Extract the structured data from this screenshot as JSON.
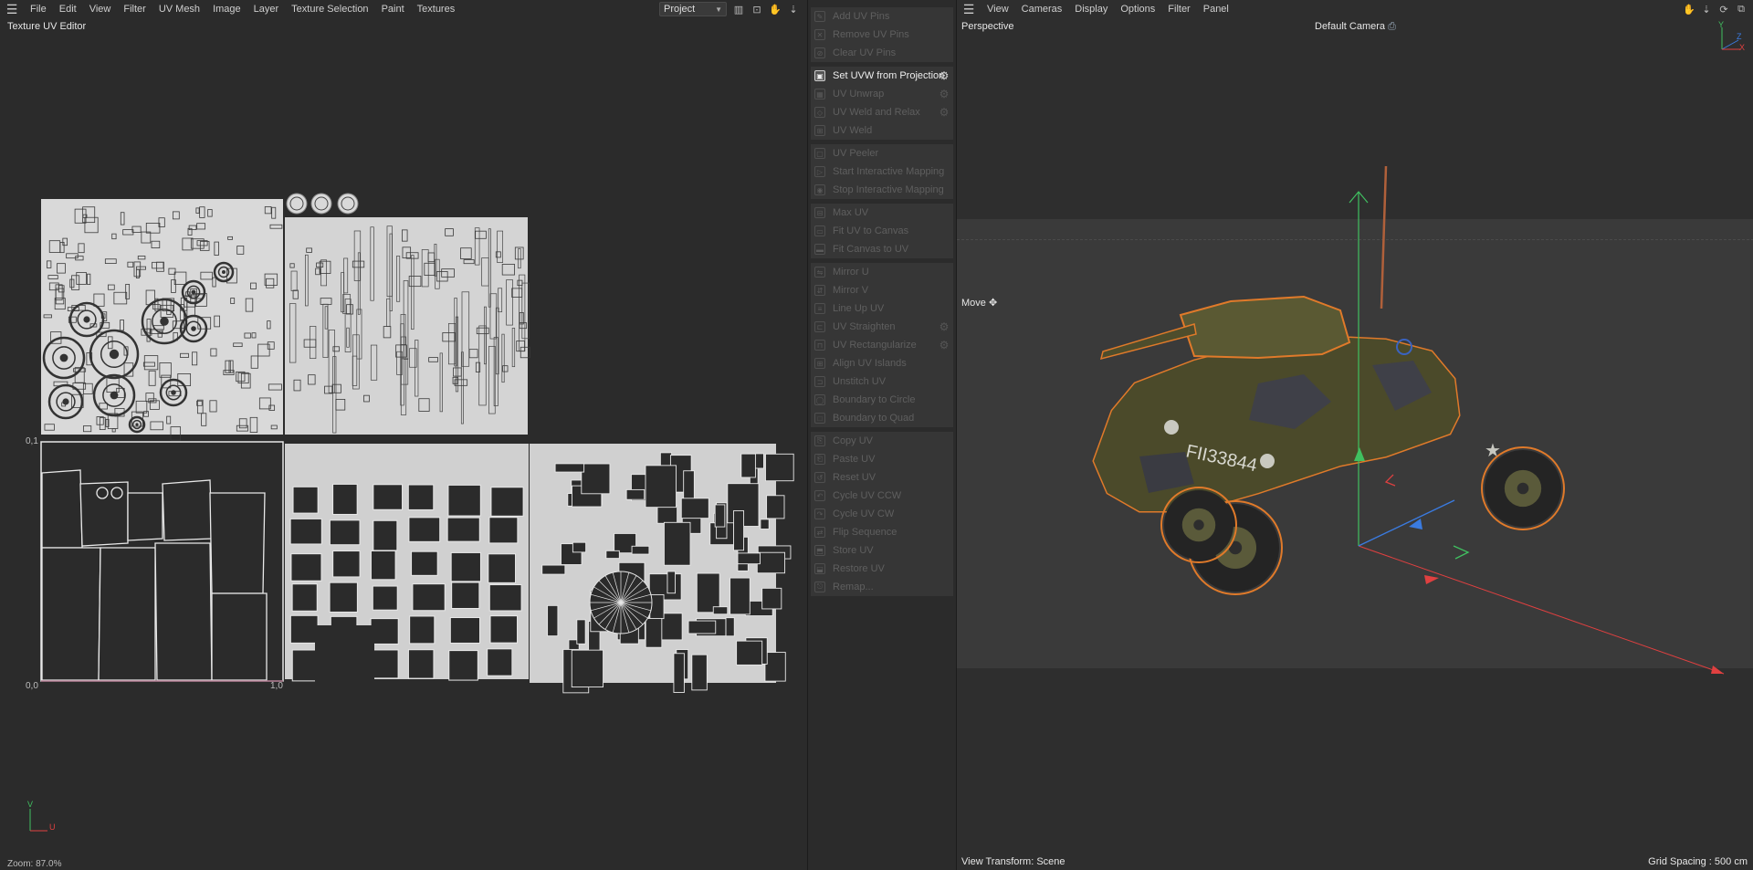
{
  "uv_editor": {
    "menu": [
      "File",
      "Edit",
      "View",
      "Filter",
      "UV Mesh",
      "Image",
      "Layer",
      "Texture Selection",
      "Paint",
      "Textures"
    ],
    "dropdown_value": "Project",
    "title": "Texture UV Editor",
    "label_01": "0,1",
    "label_00": "0,0",
    "label_10": "1,0",
    "axis_v": "V",
    "axis_u": "U",
    "zoom": "Zoom: 87.0%"
  },
  "uv_commands": {
    "groups": [
      [
        {
          "label": "Add UV Pins",
          "icon": "pin-icon"
        },
        {
          "label": "Remove UV Pins",
          "icon": "pin-remove-icon"
        },
        {
          "label": "Clear UV Pins",
          "icon": "clear-icon"
        }
      ],
      [
        {
          "label": "Set UVW from Projection",
          "icon": "projection-icon",
          "gear": true,
          "active": true
        },
        {
          "label": "UV Unwrap",
          "icon": "unwrap-icon",
          "gear": true
        },
        {
          "label": "UV Weld and Relax",
          "icon": "weld-relax-icon",
          "gear": true
        },
        {
          "label": "UV Weld",
          "icon": "weld-icon"
        }
      ],
      [
        {
          "label": "UV Peeler",
          "icon": "peeler-icon"
        },
        {
          "label": "Start Interactive Mapping",
          "icon": "play-icon"
        },
        {
          "label": "Stop Interactive Mapping",
          "icon": "stop-icon"
        }
      ],
      [
        {
          "label": "Max UV",
          "icon": "max-uv-icon"
        },
        {
          "label": "Fit UV to Canvas",
          "icon": "fit-uv-icon"
        },
        {
          "label": "Fit Canvas to UV",
          "icon": "fit-canvas-icon"
        }
      ],
      [
        {
          "label": "Mirror U",
          "icon": "mirror-u-icon"
        },
        {
          "label": "Mirror V",
          "icon": "mirror-v-icon"
        },
        {
          "label": "Line Up UV",
          "icon": "line-up-icon"
        },
        {
          "label": "UV Straighten",
          "icon": "straighten-icon",
          "gear": true
        },
        {
          "label": "UV Rectangularize",
          "icon": "rectangularize-icon",
          "gear": true
        },
        {
          "label": "Align UV Islands",
          "icon": "align-icon"
        },
        {
          "label": "Unstitch UV",
          "icon": "unstitch-icon"
        },
        {
          "label": "Boundary to Circle",
          "icon": "circle-icon"
        },
        {
          "label": "Boundary to Quad",
          "icon": "quad-icon"
        }
      ],
      [
        {
          "label": "Copy UV",
          "icon": "copy-icon"
        },
        {
          "label": "Paste UV",
          "icon": "paste-icon"
        },
        {
          "label": "Reset UV",
          "icon": "reset-icon"
        },
        {
          "label": "Cycle UV CCW",
          "icon": "cycle-ccw-icon"
        },
        {
          "label": "Cycle UV CW",
          "icon": "cycle-cw-icon"
        },
        {
          "label": "Flip Sequence",
          "icon": "flip-icon"
        },
        {
          "label": "Store UV",
          "icon": "store-icon"
        },
        {
          "label": "Restore UV",
          "icon": "restore-icon"
        },
        {
          "label": "Remap...",
          "icon": "remap-icon"
        }
      ]
    ]
  },
  "viewport": {
    "menu": [
      "View",
      "Cameras",
      "Display",
      "Options",
      "Filter",
      "Panel"
    ],
    "view_name": "Perspective",
    "camera": "Default Camera",
    "tool": "Move",
    "transform": "View Transform: Scene",
    "grid_spacing": "Grid Spacing : 500 cm",
    "vehicle_marking": "FII33844",
    "axis_y": "Y",
    "axis_z": "Z",
    "axis_x": "X"
  },
  "colors": {
    "background": "#2b2b2b",
    "uv_wire": "#e8e8e8",
    "selection_outline": "#e07a2a",
    "vehicle_body": "#4b4a2a",
    "axis_x": "#e04040",
    "axis_y": "#40c060",
    "axis_z": "#3a7be0"
  }
}
